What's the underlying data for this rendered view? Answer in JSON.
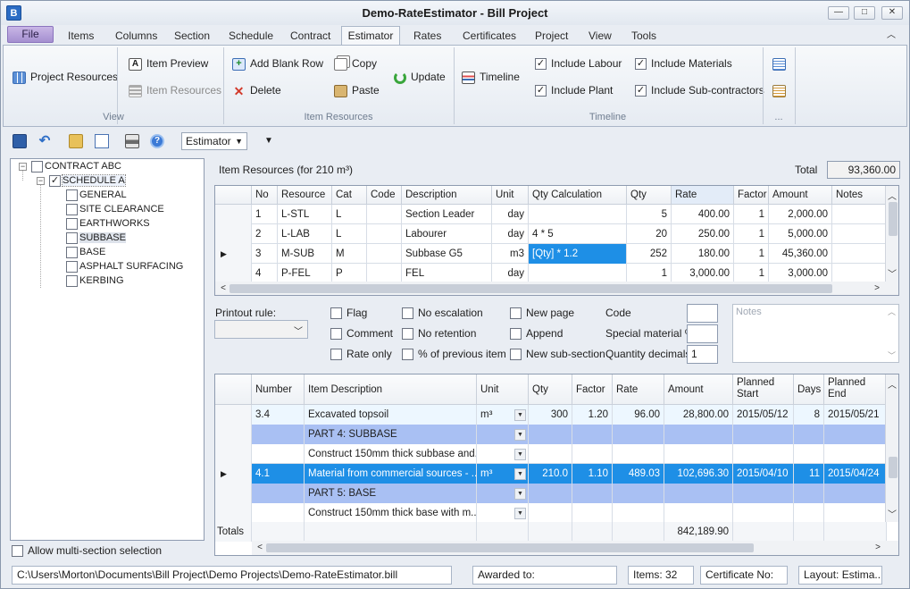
{
  "window": {
    "title": "Demo-RateEstimator - Bill Project",
    "app_icon": "B",
    "minimize": "—",
    "maximize": "□",
    "close": "✕"
  },
  "menu_tabs": [
    "File",
    "Items",
    "Columns",
    "Section",
    "Schedule",
    "Contract",
    "Estimator",
    "Rates",
    "Certificates",
    "Project",
    "View",
    "Tools"
  ],
  "active_tab": "Estimator",
  "ribbon": {
    "view": {
      "project_resources": "Project Resources",
      "item_preview": "Item Preview",
      "item_resources": "Item Resources",
      "group": "View"
    },
    "item_resources": {
      "add_blank_row": "Add Blank Row",
      "delete": "Delete",
      "copy": "Copy",
      "paste": "Paste",
      "update": "Update",
      "group": "Item Resources"
    },
    "timeline": {
      "timeline": "Timeline",
      "include_labour": "Include Labour",
      "include_plant": "Include Plant",
      "include_materials": "Include Materials",
      "include_subcontractors": "Include Sub-contractors",
      "group": "Timeline"
    },
    "more": "..."
  },
  "toolbar": {
    "layout_combo": "Estimator"
  },
  "tree": {
    "root": "CONTRACT ABC",
    "schedule": "SCHEDULE A",
    "sections": [
      "GENERAL",
      "SITE CLEARANCE",
      "EARTHWORKS",
      "SUBBASE",
      "BASE",
      "ASPHALT SURFACING",
      "KERBING"
    ],
    "multi_section": "Allow multi-section selection"
  },
  "resources": {
    "heading": "Item Resources (for 210 m³)",
    "total_label": "Total",
    "total": "93,360.00",
    "columns": [
      "No",
      "Resource",
      "Cat",
      "Code",
      "Description",
      "Unit",
      "Qty Calculation",
      "Qty",
      "Rate",
      "Factor",
      "Amount",
      "Notes"
    ],
    "rows": [
      {
        "no": "1",
        "resource": "L-STL",
        "cat": "L",
        "code": "",
        "description": "Section Leader",
        "unit": "day",
        "calc": "",
        "qty": "5",
        "rate": "400.00",
        "factor": "1",
        "amount": "2,000.00",
        "notes": ""
      },
      {
        "no": "2",
        "resource": "L-LAB",
        "cat": "L",
        "code": "",
        "description": "Labourer",
        "unit": "day",
        "calc": "4 * 5",
        "qty": "20",
        "rate": "250.00",
        "factor": "1",
        "amount": "5,000.00",
        "notes": ""
      },
      {
        "no": "3",
        "resource": "M-SUB",
        "cat": "M",
        "code": "",
        "description": "Subbase G5",
        "unit": "m3",
        "calc": "[Qty] * 1.2",
        "qty": "252",
        "rate": "180.00",
        "factor": "1",
        "amount": "45,360.00",
        "notes": ""
      },
      {
        "no": "4",
        "resource": "P-FEL",
        "cat": "P",
        "code": "",
        "description": "FEL",
        "unit": "day",
        "calc": "",
        "qty": "1",
        "rate": "3,000.00",
        "factor": "1",
        "amount": "3,000.00",
        "notes": ""
      }
    ]
  },
  "options": {
    "printout_rule": "Printout rule:",
    "flag": "Flag",
    "comment": "Comment",
    "rate_only": "Rate only",
    "no_escalation": "No escalation",
    "no_retention": "No retention",
    "pct_previous": "% of previous item",
    "new_page": "New page",
    "append": "Append",
    "new_subsection": "New sub-section",
    "code": "Code",
    "special_material": "Special material %",
    "quantity_decimals": "Quantity decimals",
    "quantity_decimals_value": "1",
    "notes_placeholder": "Notes"
  },
  "items": {
    "columns": [
      "Number",
      "Item Description",
      "Unit",
      "Qty",
      "Factor",
      "Rate",
      "Amount",
      "Planned Start",
      "Days",
      "Planned End"
    ],
    "rows": [
      {
        "number": "3.4",
        "description": "Excavated topsoil",
        "unit": "m³",
        "qty": "300",
        "factor": "1.20",
        "rate": "96.00",
        "amount": "28,800.00",
        "start": "2015/05/12",
        "days": "8",
        "end": "2015/05/21",
        "kind": "current"
      },
      {
        "number": "",
        "description": "PART 4: SUBBASE",
        "unit": "",
        "qty": "",
        "factor": "",
        "rate": "",
        "amount": "",
        "start": "",
        "days": "",
        "end": "",
        "kind": "band"
      },
      {
        "number": "",
        "description": "Construct 150mm thick subbase and...",
        "unit": "",
        "qty": "",
        "factor": "",
        "rate": "",
        "amount": "",
        "start": "",
        "days": "",
        "end": "",
        "kind": "plain"
      },
      {
        "number": "4.1",
        "description": "Material from commercial sources - ...",
        "unit": "m³",
        "qty": "210.0",
        "factor": "1.10",
        "rate": "489.03",
        "amount": "102,696.30",
        "start": "2015/04/10",
        "days": "11",
        "end": "2015/04/24",
        "kind": "selected"
      },
      {
        "number": "",
        "description": "PART 5: BASE",
        "unit": "",
        "qty": "",
        "factor": "",
        "rate": "",
        "amount": "",
        "start": "",
        "days": "",
        "end": "",
        "kind": "band"
      },
      {
        "number": "",
        "description": "Construct 150mm thick base with m...",
        "unit": "",
        "qty": "",
        "factor": "",
        "rate": "",
        "amount": "",
        "start": "",
        "days": "",
        "end": "",
        "kind": "plain"
      }
    ],
    "totals_label": "Totals",
    "totals_amount": "842,189.90"
  },
  "status": {
    "path": "C:\\Users\\Morton\\Documents\\Bill Project\\Demo Projects\\Demo-RateEstimator.bill",
    "awarded": "Awarded to:",
    "items": "Items: 32",
    "certificate": "Certificate No:",
    "layout": "Layout: Estima..."
  }
}
